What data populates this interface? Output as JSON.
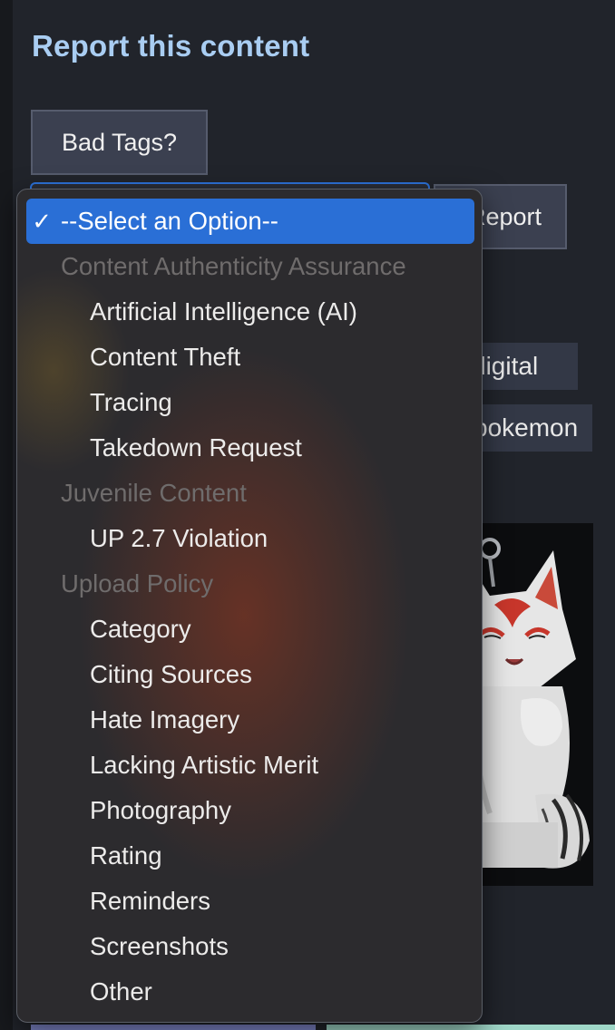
{
  "heading": "Report this content",
  "buttons": {
    "bad_tags": "Bad Tags?",
    "report": "Report"
  },
  "tags": {
    "digital": "digital",
    "pokemon": "pokemon"
  },
  "select": {
    "selected": "--Select an Option--",
    "check_glyph": "✓",
    "groups": [
      {
        "label": "Content Authenticity Assurance",
        "options": [
          "Artificial Intelligence (AI)",
          "Content Theft",
          "Tracing",
          "Takedown Request"
        ]
      },
      {
        "label": "Juvenile Content",
        "options": [
          "UP 2.7 Violation"
        ]
      },
      {
        "label": "Upload Policy",
        "options": [
          "Category",
          "Citing Sources",
          "Hate Imagery",
          "Lacking Artistic Merit",
          "Photography",
          "Rating",
          "Reminders",
          "Screenshots",
          "Other"
        ]
      }
    ]
  },
  "colors": {
    "heading": "#a9cdf2",
    "selection": "#2a6fd6",
    "group_label": "#6f6c6c",
    "background": "#21242b"
  }
}
